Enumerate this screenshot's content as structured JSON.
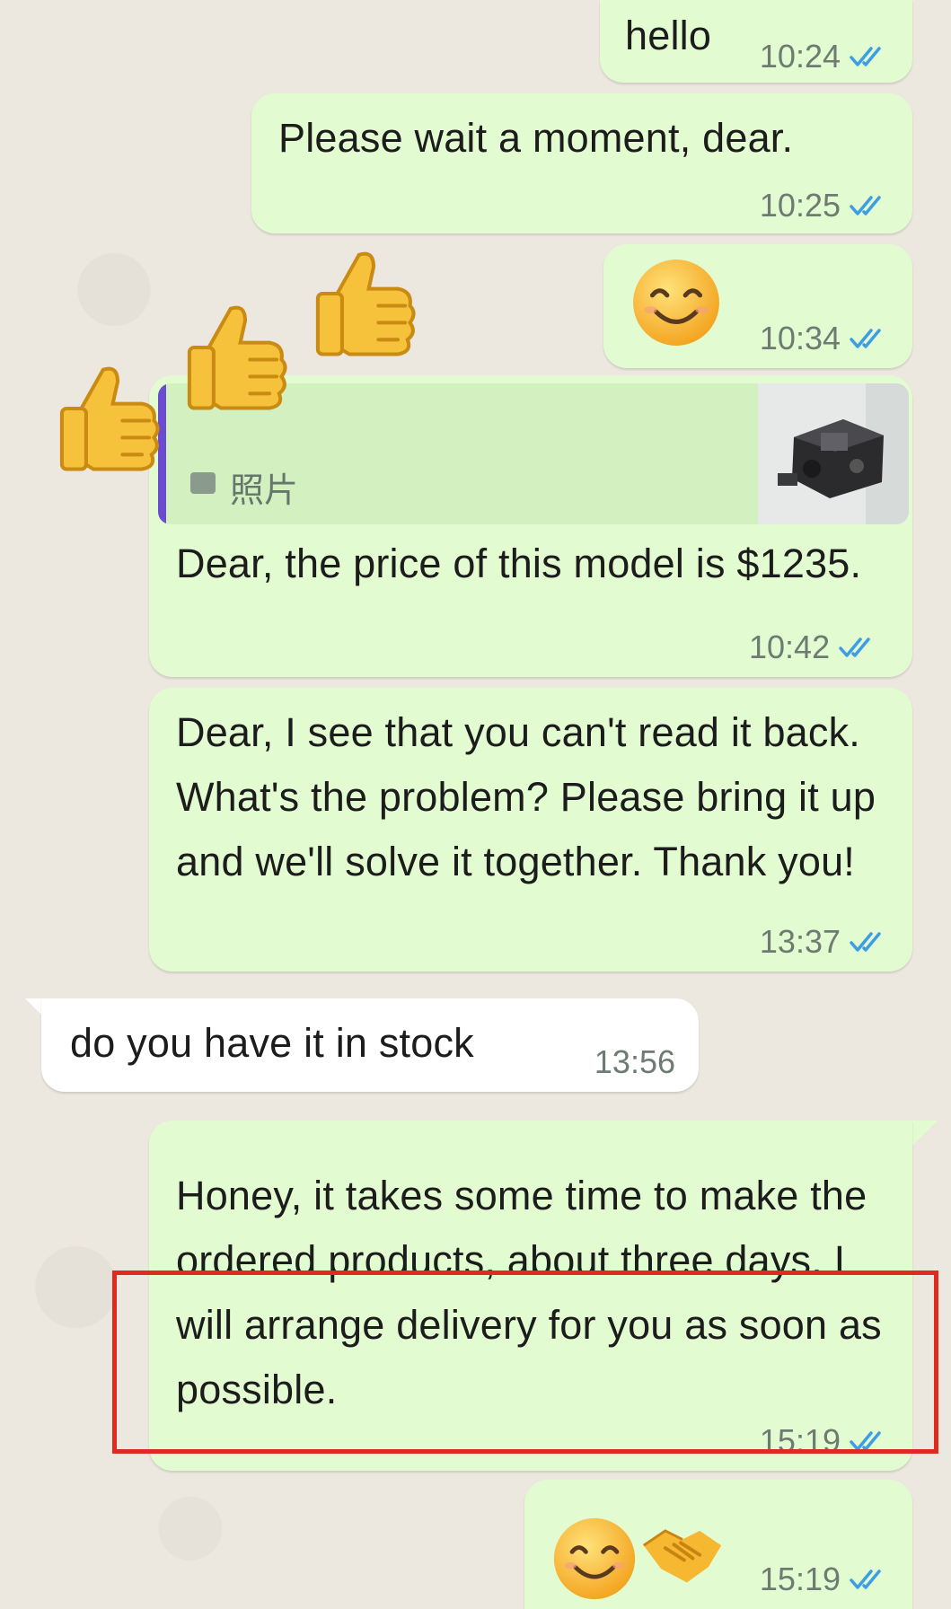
{
  "colors": {
    "outgoing_bubble": "#e2fbd0",
    "incoming_bubble": "#ffffff",
    "read_ticks": "#3d9ee6",
    "highlight_box": "#e02a20",
    "quote_bar": "#6a4bd1"
  },
  "messages": [
    {
      "id": "m1",
      "direction": "outgoing",
      "text": "hello",
      "time": "10:24",
      "status": "read"
    },
    {
      "id": "m2",
      "direction": "outgoing",
      "text": "Please wait a moment, dear.",
      "time": "10:25",
      "status": "read"
    },
    {
      "id": "m3",
      "direction": "outgoing",
      "text": "😊",
      "time": "10:34",
      "status": "read"
    },
    {
      "id": "m4",
      "direction": "outgoing",
      "text": "Dear, the price of this model is $1235.",
      "time": "10:42",
      "status": "read",
      "reply_to": {
        "label": "照片",
        "icon": "photo-icon",
        "thumbnail": "hydraulic-pump-photo"
      }
    },
    {
      "id": "m5",
      "direction": "outgoing",
      "text": "Dear, I see that you can't read it back. What's the problem? Please bring it up and we'll solve it together. Thank you!",
      "time": "13:37",
      "status": "read"
    },
    {
      "id": "m6",
      "direction": "incoming",
      "text": "do you have it in stock",
      "time": "13:56"
    },
    {
      "id": "m7",
      "direction": "outgoing",
      "text": "Honey, it takes some time to make the ordered products, about three days. I will arrange delivery for you as soon as possible.",
      "time": "15:19",
      "status": "read",
      "highlighted": true
    },
    {
      "id": "m8",
      "direction": "outgoing",
      "text": "😊🤝",
      "time": "15:19",
      "status": "read"
    }
  ],
  "reactions": {
    "emoji": "👍",
    "count": 3,
    "icon": "thumbs-up-icon"
  }
}
